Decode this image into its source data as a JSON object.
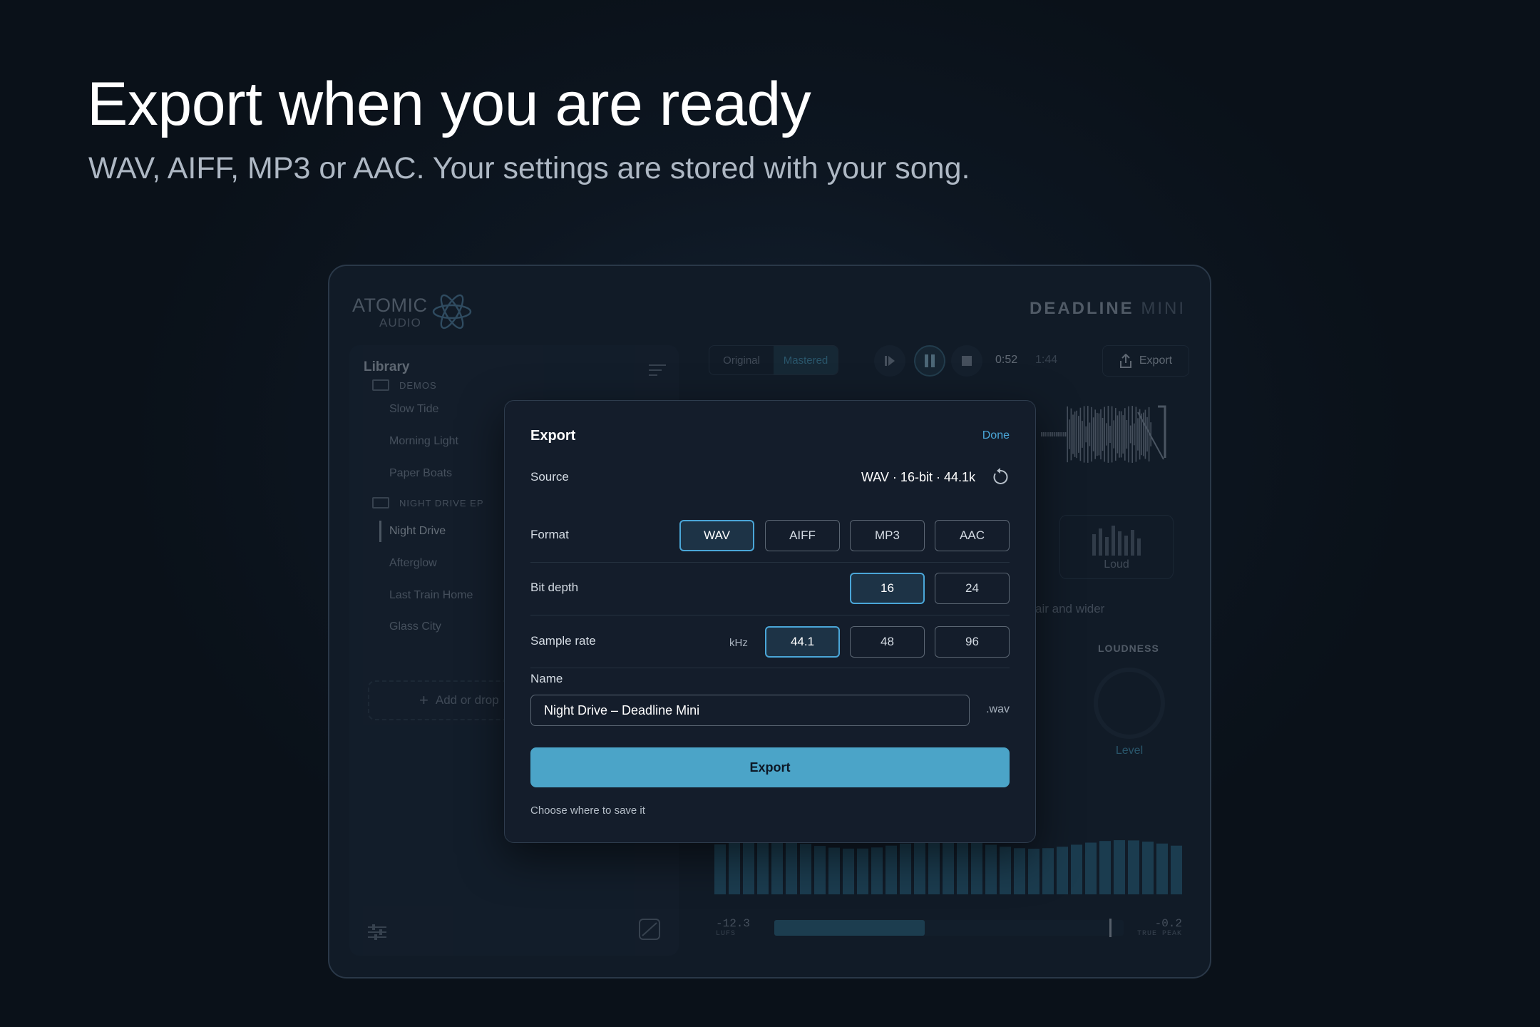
{
  "hero": {
    "title": "Export when you are ready",
    "subtitle": "WAV, AIFF, MP3 or AAC. Your settings are stored with your song."
  },
  "app": {
    "logo": {
      "line1": "ATOMIC",
      "line2": "AUDIO"
    },
    "product": {
      "name": "DEADLINE",
      "suffix": "MINI"
    },
    "library": {
      "title": "Library",
      "folders": [
        {
          "name": "DEMOS",
          "songs": [
            "Slow Tide",
            "Morning Light",
            "Paper Boats"
          ]
        },
        {
          "name": "NIGHT DRIVE EP",
          "songs": [
            "Night Drive",
            "Afterglow",
            "Last Train Home",
            "Glass City"
          ]
        }
      ],
      "active_song": "Night Drive",
      "add_label": "Add or drop"
    },
    "transport": {
      "modes": [
        "Original",
        "Mastered"
      ],
      "active_mode": "Mastered",
      "current_time": "0:52",
      "total_time": "1:44",
      "export_label": "Export"
    },
    "preset": {
      "label": "Loud"
    },
    "hint": "air and wider",
    "loudness": {
      "title": "LOUDNESS",
      "knob_label": "Level",
      "level": 0.08
    },
    "meters": {
      "lufs_value": "-12.3",
      "lufs_unit": "LUFS",
      "peak_value": "-0.2",
      "peak_unit": "TRUE PEAK",
      "fill": 0.43
    }
  },
  "export_dialog": {
    "title": "Export",
    "done_label": "Done",
    "source": {
      "label": "Source",
      "value": "WAV · 16-bit · 44.1k"
    },
    "format": {
      "label": "Format",
      "options": [
        "WAV",
        "AIFF",
        "MP3",
        "AAC"
      ],
      "selected": "WAV"
    },
    "bit_depth": {
      "label": "Bit depth",
      "options": [
        "16",
        "24"
      ],
      "selected": "16"
    },
    "sample_rate": {
      "label": "Sample rate",
      "unit": "kHz",
      "options": [
        "44.1",
        "48",
        "96"
      ],
      "selected": "44.1"
    },
    "name": {
      "label": "Name",
      "value": "Night Drive – Deadline Mini",
      "extension": ".wav"
    },
    "export_label": "Export",
    "save_location_label": "Choose where to save it"
  },
  "colors": {
    "accent": "#4aa6d8",
    "button": "#4ba4c8",
    "background": "#0b131d",
    "dialog": "#141d2b"
  }
}
